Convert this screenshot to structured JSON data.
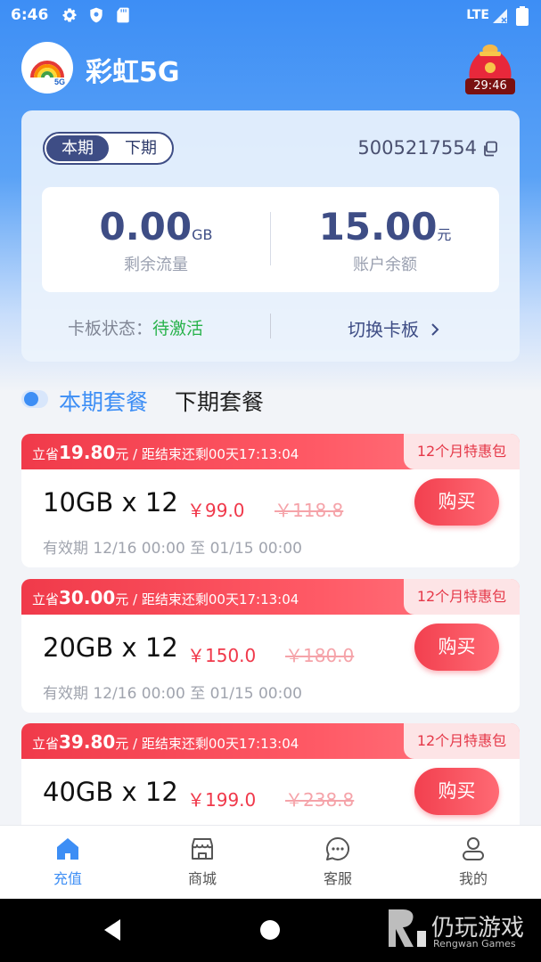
{
  "status_bar": {
    "time": "6:46",
    "network": "LTE"
  },
  "header": {
    "app_name": "彩虹5G",
    "gift_timer": "29:46"
  },
  "account": {
    "period_current": "本期",
    "period_next": "下期",
    "number": "5005217554",
    "data_value": "0.00",
    "data_unit": "GB",
    "data_label": "剩余流量",
    "balance_value": "15.00",
    "balance_unit": "元",
    "balance_label": "账户余额",
    "card_state_label": "卡板状态：",
    "card_state_value": "待激活",
    "switch_label": "切换卡板"
  },
  "package_tabs": {
    "current": "本期套餐",
    "next": "下期套餐"
  },
  "packages": [
    {
      "save_prefix": "立省",
      "save_amount": "19.80",
      "save_suffix": "元 / 距结束还剩00天17:13:04",
      "tag": "12个月特惠包",
      "name": "10GB x 12",
      "price": "￥99.0",
      "old_price": "￥118.8",
      "validity": "有效期 12/16 00:00 至 01/15 00:00",
      "buy": "购买"
    },
    {
      "save_prefix": "立省",
      "save_amount": "30.00",
      "save_suffix": "元 / 距结束还剩00天17:13:04",
      "tag": "12个月特惠包",
      "name": "20GB x 12",
      "price": "￥150.0",
      "old_price": "￥180.0",
      "validity": "有效期 12/16 00:00 至 01/15 00:00",
      "buy": "购买"
    },
    {
      "save_prefix": "立省",
      "save_amount": "39.80",
      "save_suffix": "元 / 距结束还剩00天17:13:04",
      "tag": "12个月特惠包",
      "name": "40GB x 12",
      "price": "￥199.0",
      "old_price": "￥238.8",
      "validity": "",
      "buy": "购买"
    }
  ],
  "bottom_nav": [
    {
      "label": "充值",
      "icon": "home-icon",
      "active": true
    },
    {
      "label": "商城",
      "icon": "store-icon",
      "active": false
    },
    {
      "label": "客服",
      "icon": "chat-icon",
      "active": false
    },
    {
      "label": "我的",
      "icon": "user-icon",
      "active": false
    }
  ],
  "watermark": {
    "brand_cn": "仍玩游戏",
    "brand_en": "Rengwan Games"
  },
  "colors": {
    "primary": "#3d8ef5",
    "accent_red": "#f0384a",
    "navy": "#3e4d85",
    "success": "#27b24a"
  }
}
